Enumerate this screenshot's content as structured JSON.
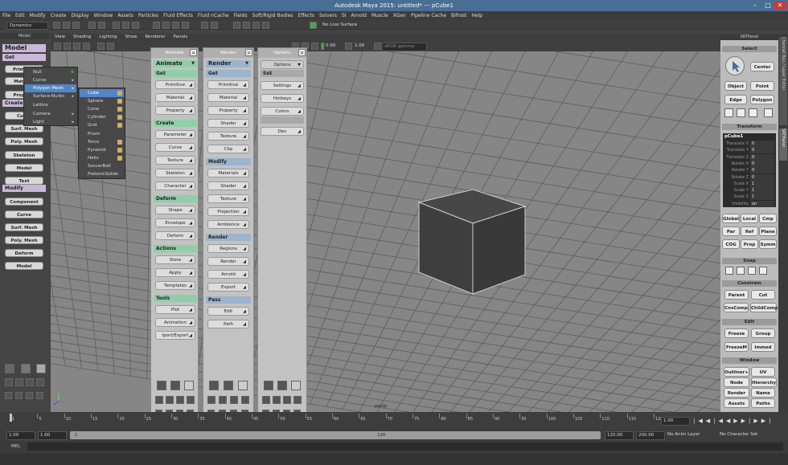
{
  "window": {
    "title": "Autodesk Maya 2015: untitled*   ---   pCube1",
    "min": "–",
    "max": "□",
    "close": "✕"
  },
  "menubar": [
    "File",
    "Edit",
    "Modify",
    "Create",
    "Display",
    "Window",
    "Assets",
    "Particles",
    "Fluid Effects",
    "Fluid nCache",
    "Fields",
    "Soft/Rigid Bodies",
    "Effects",
    "Solvers",
    "SI",
    "Arnold",
    "Muscle",
    "XGen",
    "Pipeline Cache",
    "Bifrost",
    "Help"
  ],
  "statusline": {
    "mode": "Dynamics",
    "live_surface": "No Live Surface"
  },
  "left_panel": {
    "title": "Model",
    "mode_select": "Model",
    "get_header": "Get",
    "get_buttons": [
      "Primitive",
      "Material",
      "Property"
    ],
    "create_header": "Create",
    "create_buttons": [
      "Curve",
      "Surf. Mesh",
      "Poly. Mesh",
      "Skeleton",
      "Model",
      "Text"
    ],
    "modify_header": "Modify",
    "modify_buttons": [
      "Component",
      "Curve",
      "Surf. Mesh",
      "Poly. Mesh",
      "Deform",
      "Model"
    ]
  },
  "primitive_menu": {
    "items": [
      "Null",
      "Curve",
      "Polygon Mesh",
      "Surface-Nurbs",
      "Lattice",
      "Camera",
      "Light"
    ],
    "selected": "Polygon Mesh"
  },
  "polygon_submenu": {
    "items": [
      "Cube",
      "Sphere",
      "Cone",
      "Cylinder",
      "Grid",
      "Prism",
      "Torus",
      "Pyramid",
      "Helix",
      "SoccerBall",
      "PlatonicSolids"
    ],
    "selected": "Cube"
  },
  "viewport": {
    "menus": [
      "View",
      "Shading",
      "Lighting",
      "Show",
      "Renderer",
      "Panels"
    ],
    "camera_label": "persp",
    "val1": "0.00",
    "val2": "1.00",
    "color_space": "sRGB gamma"
  },
  "animate_panel": {
    "title": "Animate",
    "mode_select": "Animate",
    "sections": [
      {
        "header": "Get",
        "buttons": [
          "Primitive",
          "Material",
          "Property"
        ]
      },
      {
        "header": "Create",
        "buttons": [
          "Parameter",
          "Curve",
          "Texture",
          "Skeleton",
          "Character"
        ]
      },
      {
        "header": "Deform",
        "buttons": [
          "Shape",
          "Envelope",
          "Deform"
        ]
      },
      {
        "header": "Actions",
        "buttons": [
          "Store",
          "Apply",
          "Templates"
        ]
      },
      {
        "header": "Tools",
        "buttons": [
          "Plot",
          "Animation",
          "Iport/Export"
        ]
      }
    ]
  },
  "render_panel": {
    "title": "Render",
    "mode_select": "Render",
    "sections": [
      {
        "header": "Get",
        "buttons": [
          "Primitive",
          "Material",
          "Property",
          "Shader",
          "Texture",
          "Clip"
        ]
      },
      {
        "header": "Modify",
        "buttons": [
          "Materials",
          "Shader",
          "Texture",
          "Projection",
          "Ambience"
        ]
      },
      {
        "header": "Render",
        "buttons": [
          "Regions",
          "Render",
          "Arnold",
          "Export"
        ]
      },
      {
        "header": "Pass",
        "buttons": [
          "Edit",
          "Path"
        ]
      }
    ]
  },
  "options_panel": {
    "title": "Options",
    "mode_select": "Options",
    "set_header": "Set",
    "buttons": [
      "Settings",
      "Hotkeys",
      "Colors",
      "Dev"
    ]
  },
  "srt_panel": {
    "title": "SRTPanel",
    "select_header": "Select",
    "center": "Center",
    "object": "Object",
    "point": "Point",
    "edge": "Edge",
    "polygon": "Polygon",
    "transform_header": "Transform",
    "channels": {
      "object_name": "pCube1",
      "rows": [
        {
          "label": "Translate X",
          "value": "0"
        },
        {
          "label": "Translate Y",
          "value": "0"
        },
        {
          "label": "Translate Z",
          "value": "0"
        },
        {
          "label": "Rotate X",
          "value": "0"
        },
        {
          "label": "Rotate Y",
          "value": "0"
        },
        {
          "label": "Rotate Z",
          "value": "0"
        },
        {
          "label": "Scale X",
          "value": "1"
        },
        {
          "label": "Scale Y",
          "value": "1"
        },
        {
          "label": "Scale Z",
          "value": "1"
        },
        {
          "label": "Visibility",
          "value": "on"
        }
      ]
    },
    "space_row1": [
      "Global",
      "Local",
      "Cmp"
    ],
    "space_row2": [
      "Par",
      "Ref",
      "Plane"
    ],
    "space_row3": [
      "COG",
      "Prop",
      "Symm"
    ],
    "snap_header": "Snap",
    "constrain_header": "Constrain",
    "constrain_buttons": [
      "Parent",
      "Cut",
      "CnsComp",
      "ChildComp"
    ],
    "edit_header": "Edit",
    "edit_buttons": [
      "Freeze",
      "Group",
      "FreezeM",
      "Immed"
    ],
    "window_header": "Window",
    "window_buttons": [
      "Outliner+",
      "UV",
      "Node",
      "Hierarchy",
      "Render",
      "Name",
      "Assets",
      "Paths"
    ]
  },
  "side_tabs": [
    "Channel Box / Layer Editor",
    "SRTPanel"
  ],
  "timeline": {
    "ticks": [
      "1",
      "5",
      "10",
      "15",
      "20",
      "25",
      "30",
      "35",
      "40",
      "45",
      "50",
      "55",
      "60",
      "65",
      "70",
      "75",
      "80",
      "85",
      "90",
      "95",
      "100",
      "105",
      "110",
      "115",
      "120"
    ],
    "current_frame": "1.00"
  },
  "range": {
    "start": "1.00",
    "anim_start": "1.00",
    "range_start_field": "1",
    "range_end_field": "120",
    "anim_end": "120.00",
    "end": "200.00",
    "anim_layer": "No Anim Layer",
    "character_set": "No Character Set"
  },
  "command_line": {
    "label": "MEL"
  }
}
